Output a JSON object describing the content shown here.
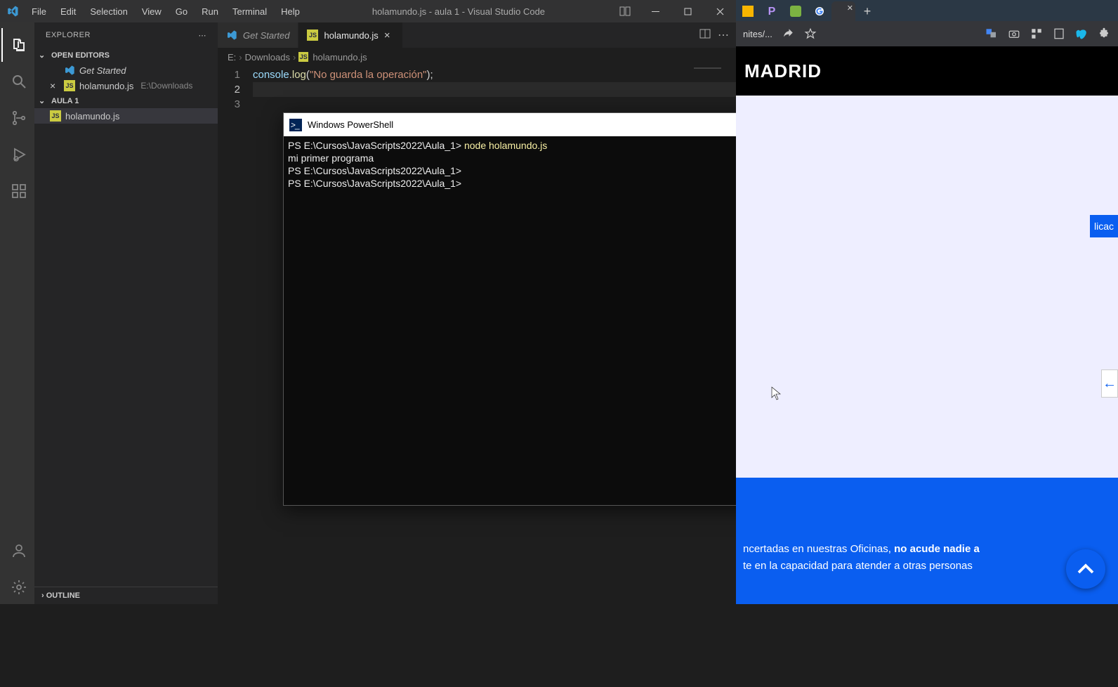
{
  "vscode": {
    "title": "holamundo.js - aula 1 - Visual Studio Code",
    "menus": [
      "File",
      "Edit",
      "Selection",
      "View",
      "Go",
      "Run",
      "Terminal",
      "Help"
    ],
    "explorer": {
      "title": "EXPLORER",
      "sections": {
        "open_editors": {
          "title": "OPEN EDITORS",
          "items": [
            {
              "label": "Get Started",
              "type": "vscode",
              "italic": true
            },
            {
              "label": "holamundo.js",
              "type": "js",
              "path": "E:\\Downloads"
            }
          ]
        },
        "folder": {
          "title": "AULA 1",
          "items": [
            {
              "label": "holamundo.js",
              "type": "js"
            }
          ]
        },
        "outline": {
          "title": "OUTLINE"
        }
      }
    },
    "tabs": [
      {
        "label": "Get Started",
        "type": "vscode",
        "italic": true,
        "active": false
      },
      {
        "label": "holamundo.js",
        "type": "js",
        "active": true
      }
    ],
    "breadcrumb": [
      "E:",
      "Downloads",
      "holamundo.js"
    ],
    "code": {
      "lines": [
        {
          "n": 1,
          "kind": "code",
          "obj": "console",
          "fn": "log",
          "str": "\"No guarda la operación\""
        },
        {
          "n": 2,
          "kind": "blank"
        },
        {
          "n": 3,
          "kind": "blank"
        }
      ],
      "current_line": 2
    }
  },
  "powershell": {
    "title": "Windows PowerShell",
    "lines": [
      {
        "prompt": "PS E:\\Cursos\\JavaScripts2022\\Aula_1>",
        "cmd": " node holamundo.js"
      },
      {
        "out": "mi primer programa"
      },
      {
        "prompt": "PS E:\\Cursos\\JavaScripts2022\\Aula_1>",
        "cmd": ""
      },
      {
        "prompt": "PS E:\\Cursos\\JavaScripts2022\\Aula_1>",
        "cmd": ""
      }
    ]
  },
  "browser": {
    "address_fragment": "nites/...",
    "madrid": "MADRID",
    "blue_text_1": "ncertadas en nuestras Oficinas, ",
    "blue_bold": "no acude nadie a",
    "blue_text_2": "te en la capacidad para atender a otras personas",
    "sidetag": "licac",
    "la": "la"
  },
  "icons": {
    "files": "files",
    "search": "search",
    "git": "git",
    "debug": "debug",
    "ext": "ext",
    "account": "account",
    "gear": "gear"
  }
}
